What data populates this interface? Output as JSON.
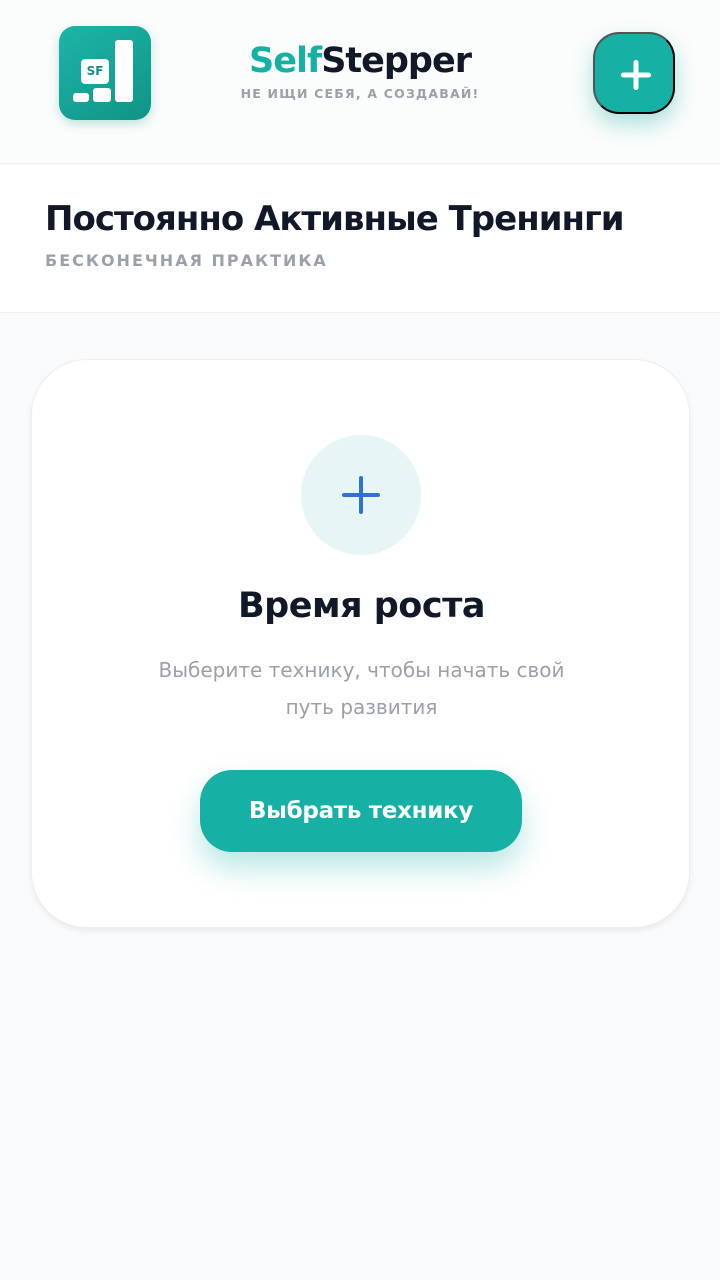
{
  "header": {
    "logo_badge": "SF",
    "brand_part1": "Self",
    "brand_part2": "Stepper",
    "tagline": "НЕ ИЩИ СЕБЯ, А СОЗДАВАЙ!",
    "add_icon": "plus-icon"
  },
  "section": {
    "title": "Постоянно Активные Тренинги",
    "subtitle": "БЕСКОНЕЧНАЯ ПРАКТИКА"
  },
  "empty_state": {
    "icon": "plus-icon",
    "title": "Время роста",
    "text": "Выберите технику, чтобы начать свой путь развития",
    "button_label": "Выбрать технику"
  },
  "colors": {
    "accent": "#17b0a4",
    "accent_light": "#e7f5f4",
    "plus_blue": "#2f73d0",
    "text_dark": "#111827",
    "text_muted": "#9aa1a9",
    "background": "#f8fafb"
  }
}
